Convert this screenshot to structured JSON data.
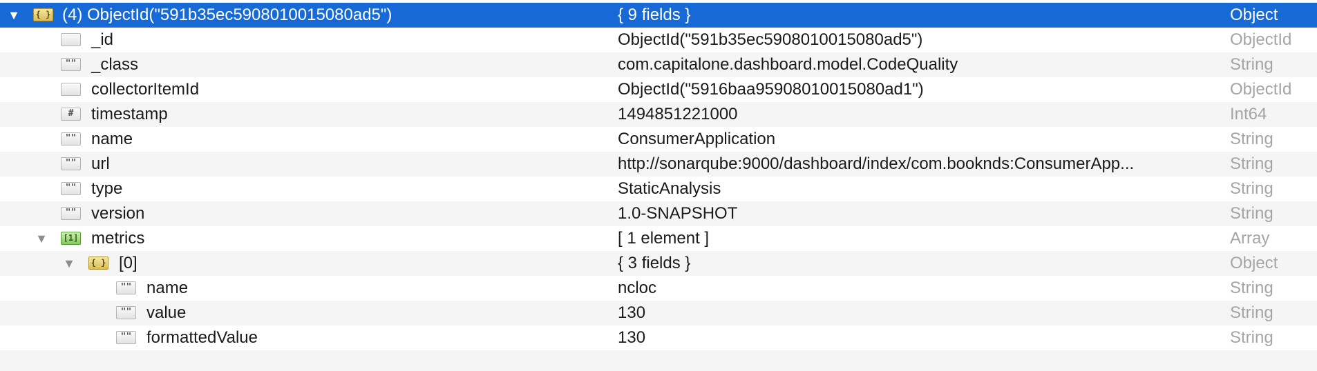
{
  "document": {
    "key": "(4) ObjectId(\"591b35ec5908010015080ad5\")",
    "value": "{ 9 fields }",
    "type": "Object",
    "disclosure": "▼"
  },
  "fields": [
    {
      "key": "_id",
      "value": "ObjectId(\"591b35ec5908010015080ad5\")",
      "type": "ObjectId",
      "icon": ""
    },
    {
      "key": "_class",
      "value": "com.capitalone.dashboard.model.CodeQuality",
      "type": "String",
      "icon": "\"\""
    },
    {
      "key": "collectorItemId",
      "value": "ObjectId(\"5916baa95908010015080ad1\")",
      "type": "ObjectId",
      "icon": ""
    },
    {
      "key": "timestamp",
      "value": "1494851221000",
      "type": "Int64",
      "icon": "#"
    },
    {
      "key": "name",
      "value": "ConsumerApplication",
      "type": "String",
      "icon": "\"\""
    },
    {
      "key": "url",
      "value": "http://sonarqube:9000/dashboard/index/com.booknds:ConsumerApp...",
      "type": "String",
      "icon": "\"\""
    },
    {
      "key": "type",
      "value": "StaticAnalysis",
      "type": "String",
      "icon": "\"\""
    },
    {
      "key": "version",
      "value": "1.0-SNAPSHOT",
      "type": "String",
      "icon": "\"\""
    }
  ],
  "metrics": {
    "key": "metrics",
    "value": "[ 1 element ]",
    "type": "Array",
    "icon": "[1]",
    "disclosure": "▼"
  },
  "element0": {
    "key": "[0]",
    "value": "{ 3 fields }",
    "type": "Object",
    "icon": "{ }",
    "disclosure": "▼"
  },
  "element0_fields": [
    {
      "key": "name",
      "value": "ncloc",
      "type": "String",
      "icon": "\"\""
    },
    {
      "key": "value",
      "value": "130",
      "type": "String",
      "icon": "\"\""
    },
    {
      "key": "formattedValue",
      "value": "130",
      "type": "String",
      "icon": "\"\""
    }
  ],
  "object_icon": "{ }",
  "colors": {
    "selection": "#1769d6",
    "stripe": "#f5f5f5",
    "type_text": "#a5a5a5",
    "object_icon": "#d9bc55",
    "array_icon": "#86c95f"
  }
}
